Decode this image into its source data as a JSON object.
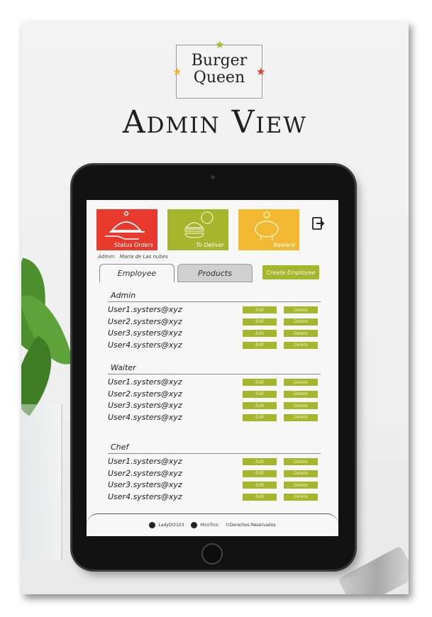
{
  "brand": {
    "line1": "Burger",
    "line2": "Queen"
  },
  "page_title": "Admin View",
  "tiles": [
    {
      "label": "Status Orders",
      "icon": "serving-cloche-icon",
      "color": "#e8392d"
    },
    {
      "label": "To Deliver",
      "icon": "burger-clock-icon",
      "color": "#a5b52c"
    },
    {
      "label": "Reward",
      "icon": "piggy-bank-icon",
      "color": "#f2b832"
    }
  ],
  "admin": {
    "label": "Admin:",
    "name": "Maria de Las nubes"
  },
  "tabs": {
    "employee": "Employee",
    "products": "Products"
  },
  "create_button": "Create Employee",
  "actions": {
    "edit": "Edit",
    "delete": "Delete"
  },
  "sections": [
    {
      "title": "Admin",
      "users": [
        "User1.systers@xyz",
        "User2.systers@xyz",
        "User3.systers@xyz",
        "User4.systers@xyz"
      ]
    },
    {
      "title": "Waiter",
      "users": [
        "User1.systers@xyz",
        "User2.systers@xyz",
        "User3.systers@xyz",
        "User4.systers@xyz"
      ]
    },
    {
      "title": "Chef",
      "users": [
        "User1.systers@xyz",
        "User2.systers@xyz",
        "User3.systers@xyz",
        "User4.systers@xyz"
      ]
    }
  ],
  "footer": {
    "github1": "LadyDi3103",
    "github2": "HicoTico",
    "rights": "©Derechos Reservados"
  },
  "colors": {
    "red": "#e8392d",
    "green": "#a5b52c",
    "yellow": "#f2b832"
  }
}
